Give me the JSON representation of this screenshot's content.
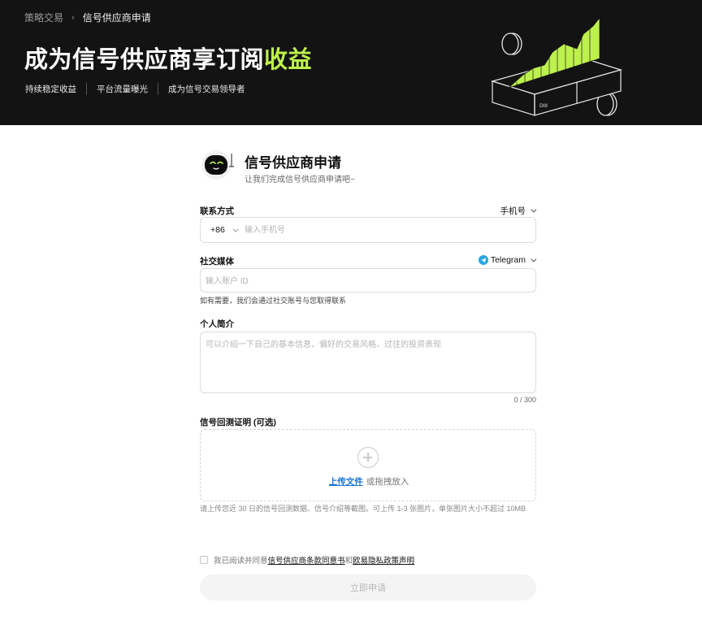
{
  "breadcrumb": {
    "parent": "策略交易",
    "separator": "›",
    "current": "信号供应商申请"
  },
  "hero": {
    "title_main": "成为信号供应商享订阅",
    "title_accent": "收益",
    "tags": [
      "持续稳定收益",
      "平台流量曝光",
      "成为信号交易领导者"
    ],
    "accent_color": "#bdf14b",
    "art_label": "DIII"
  },
  "form": {
    "title": "信号供应商申请",
    "subtitle": "让我们完成信号供应商申请吧~",
    "contact": {
      "label": "联系方式",
      "method": "手机号",
      "country_code": "+86",
      "placeholder": "输入手机号",
      "value": ""
    },
    "social": {
      "label": "社交媒体",
      "platform": "Telegram",
      "placeholder": "输入账户 ID",
      "value": "",
      "hint": "如有需要，我们会通过社交账号与您取得联系"
    },
    "bio": {
      "label": "个人简介",
      "placeholder": "可以介绍一下自己的基本信息、偏好的交易风格、过往的投资表现",
      "value": "",
      "counter": "0 / 300"
    },
    "proof": {
      "label": "信号回测证明 (可选)",
      "upload_link": "上传文件",
      "upload_suffix": "或拖拽放入",
      "hint": "请上传您近 30 日的信号回测数据、信号介绍等截图。可上传 1-3 张图片，单张图片大小不超过 10MB"
    },
    "agreement": {
      "prefix": "我已阅读并同意",
      "terms": "信号供应商条款同意书",
      "joiner": "和",
      "privacy": "欧易隐私政策声明",
      "checked": false
    },
    "submit_label": "立即申请"
  }
}
